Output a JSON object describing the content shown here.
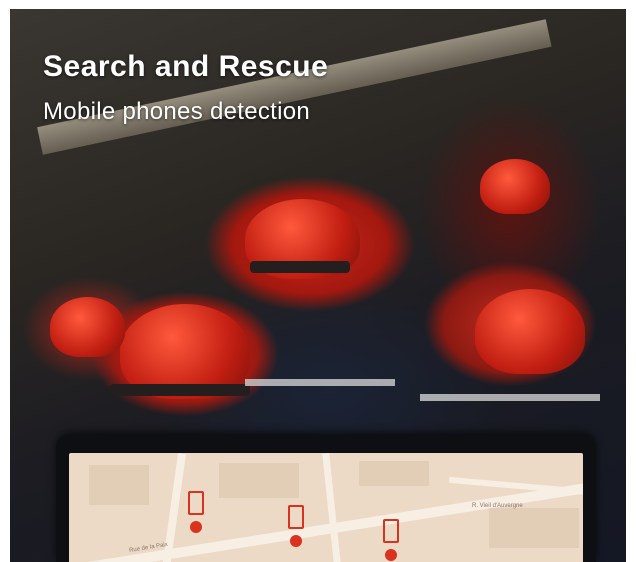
{
  "hero": {
    "title": "Search and Rescue",
    "subtitle": "Mobile phones detection"
  },
  "map": {
    "street_labels": [
      "R. Vieil d'Auvergne",
      "Rue de la Paix"
    ],
    "markers": [
      {
        "icon": "phone-icon",
        "color": "#d9321f"
      },
      {
        "icon": "phone-icon",
        "color": "#d9321f"
      },
      {
        "icon": "phone-icon",
        "color": "#d9321f"
      }
    ]
  }
}
